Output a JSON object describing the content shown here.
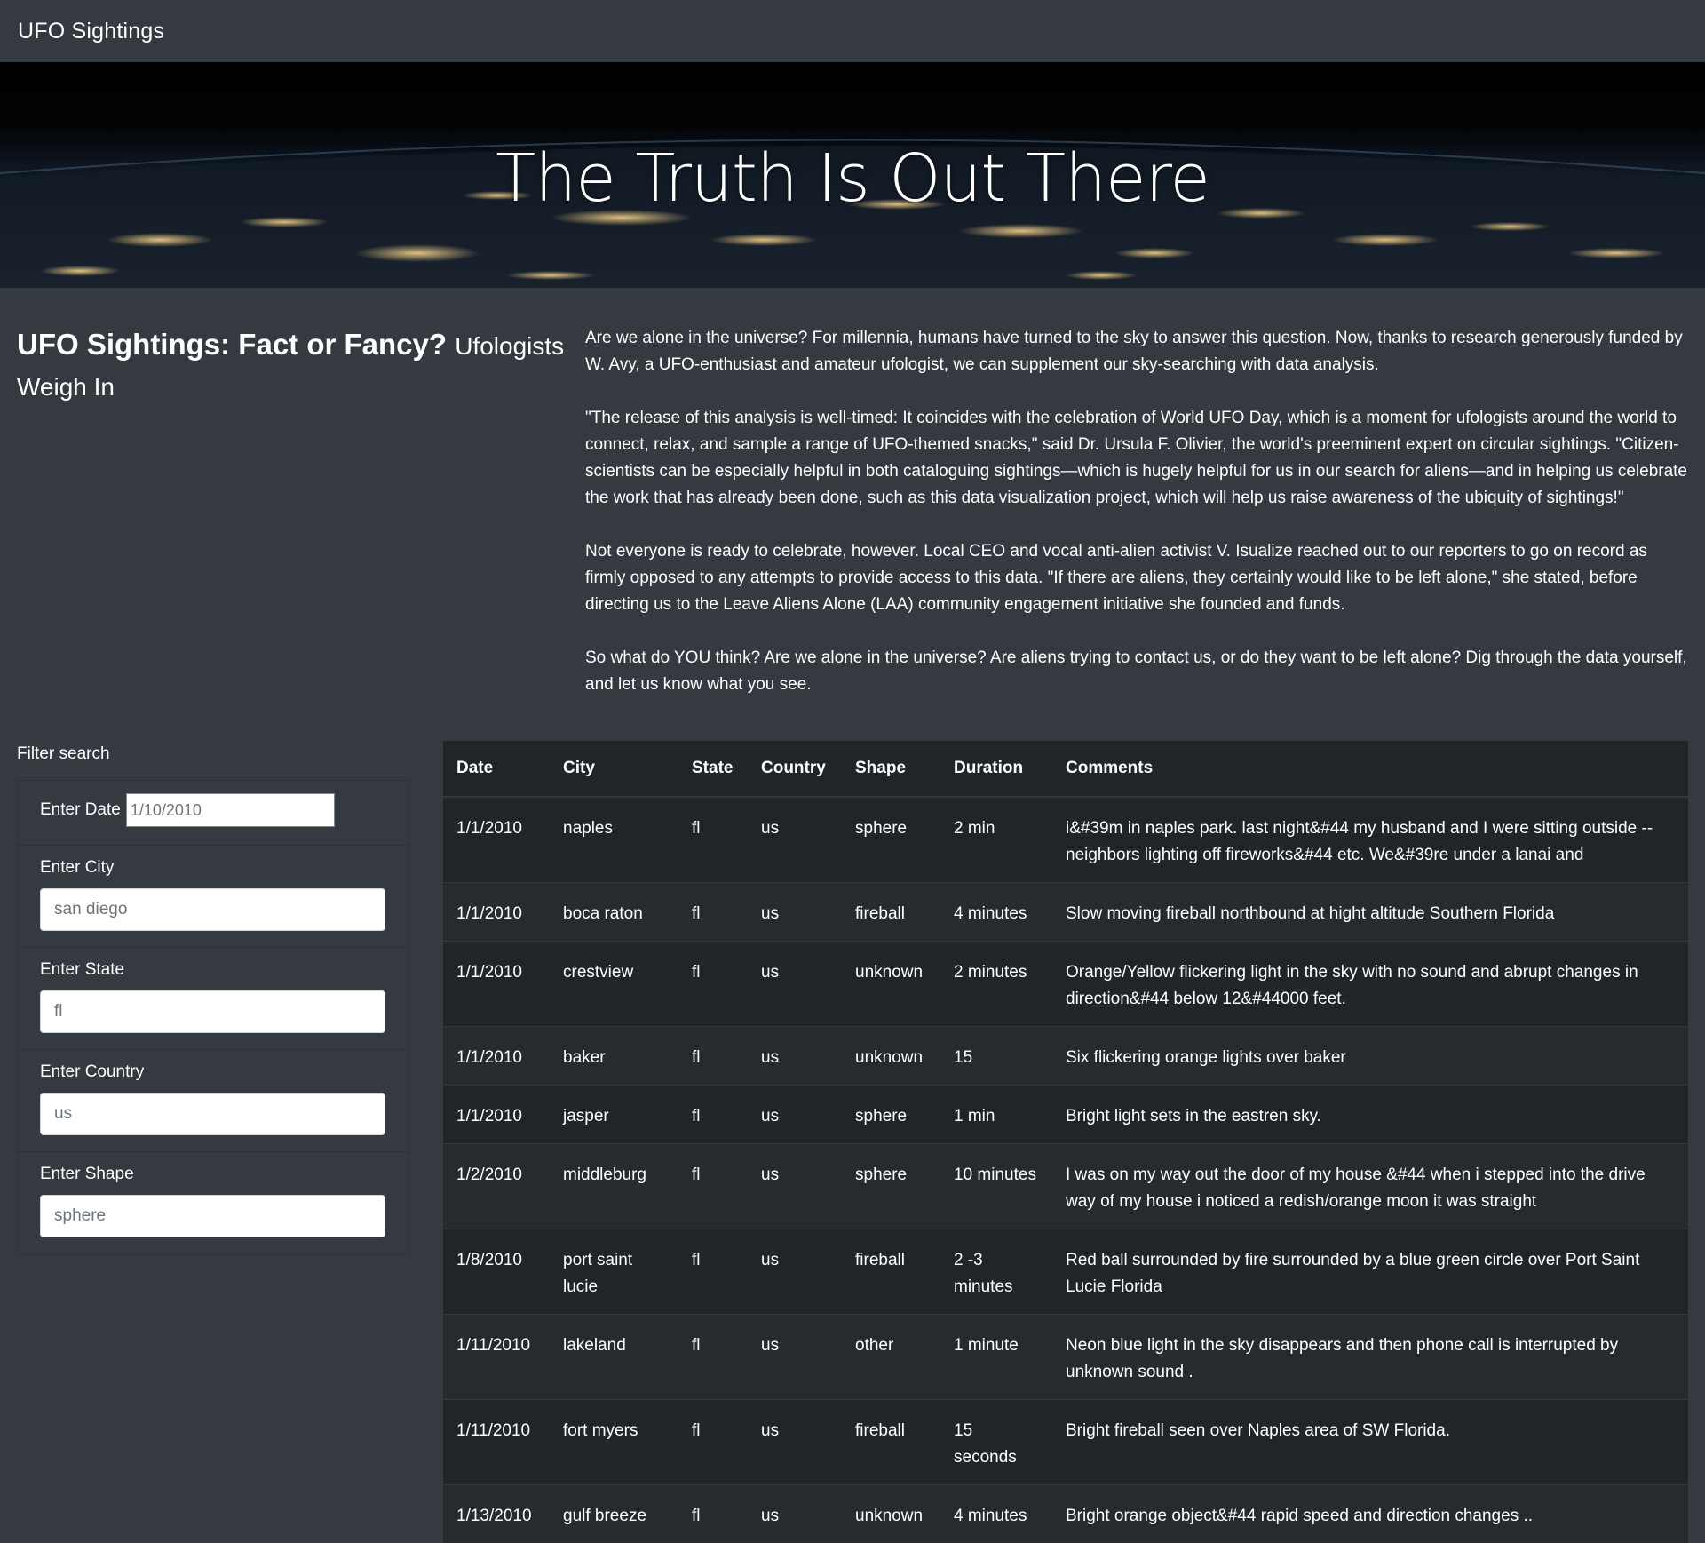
{
  "navbar": {
    "brand": "UFO Sightings"
  },
  "hero": {
    "title": "The Truth Is Out There"
  },
  "intro": {
    "heading": "UFO Sightings: Fact or Fancy?",
    "subheading": "Ufologists Weigh In",
    "paragraphs": [
      "Are we alone in the universe? For millennia, humans have turned to the sky to answer this question. Now, thanks to research generously funded by W. Avy, a UFO-enthusiast and amateur ufologist, we can supplement our sky-searching with data analysis.",
      "\"The release of this analysis is well-timed: It coincides with the celebration of World UFO Day, which is a moment for ufologists around the world to connect, relax, and sample a range of UFO-themed snacks,\" said Dr. Ursula F. Olivier, the world's preeminent expert on circular sightings. \"Citizen-scientists can be especially helpful in both cataloguing sightings—which is hugely helpful for us in our search for aliens—and in helping us celebrate the work that has already been done, such as this data visualization project, which will help us raise awareness of the ubiquity of sightings!\"",
      "Not everyone is ready to celebrate, however. Local CEO and vocal anti-alien activist V. Isualize reached out to our reporters to go on record as firmly opposed to any attempts to provide access to this data. \"If there are aliens, they certainly would like to be left alone,\" she stated, before directing us to the Leave Aliens Alone (LAA) community engagement initiative she founded and funds.",
      "So what do YOU think? Are we alone in the universe? Are aliens trying to contact us, or do they want to be left alone? Dig through the data yourself, and let us know what you see."
    ]
  },
  "filters": {
    "title": "Filter search",
    "date": {
      "label": "Enter Date",
      "placeholder": "1/10/2010"
    },
    "city": {
      "label": "Enter City",
      "placeholder": "san diego"
    },
    "state": {
      "label": "Enter State",
      "placeholder": "fl"
    },
    "country": {
      "label": "Enter Country",
      "placeholder": "us"
    },
    "shape": {
      "label": "Enter Shape",
      "placeholder": "sphere"
    }
  },
  "table": {
    "headers": {
      "date": "Date",
      "city": "City",
      "state": "State",
      "country": "Country",
      "shape": "Shape",
      "duration": "Duration",
      "comments": "Comments"
    },
    "rows": [
      {
        "date": "1/1/2010",
        "city": "naples",
        "state": "fl",
        "country": "us",
        "shape": "sphere",
        "duration": "2 min",
        "comments": "i&#39m in naples park. last night&#44 my husband and I were sitting outside --neighbors lighting off fireworks&#44 etc. We&#39re under a lanai and"
      },
      {
        "date": "1/1/2010",
        "city": "boca raton",
        "state": "fl",
        "country": "us",
        "shape": "fireball",
        "duration": "4 minutes",
        "comments": "Slow moving fireball northbound at hight altitude Southern Florida"
      },
      {
        "date": "1/1/2010",
        "city": "crestview",
        "state": "fl",
        "country": "us",
        "shape": "unknown",
        "duration": "2 minutes",
        "comments": "Orange/Yellow flickering light in the sky with no sound and abrupt changes in direction&#44 below 12&#44000 feet."
      },
      {
        "date": "1/1/2010",
        "city": "baker",
        "state": "fl",
        "country": "us",
        "shape": "unknown",
        "duration": "15",
        "comments": "Six flickering orange lights over baker"
      },
      {
        "date": "1/1/2010",
        "city": "jasper",
        "state": "fl",
        "country": "us",
        "shape": "sphere",
        "duration": "1 min",
        "comments": "Bright light sets in the eastren sky."
      },
      {
        "date": "1/2/2010",
        "city": "middleburg",
        "state": "fl",
        "country": "us",
        "shape": "sphere",
        "duration": "10 minutes",
        "comments": "I was on my way out the door of my house &#44 when i stepped into the drive way of my house i noticed a redish/orange moon it was straight"
      },
      {
        "date": "1/8/2010",
        "city": "port saint lucie",
        "state": "fl",
        "country": "us",
        "shape": "fireball",
        "duration": "2 -3 minutes",
        "comments": "Red ball surrounded by fire surrounded by a blue green circle over Port Saint Lucie Florida"
      },
      {
        "date": "1/11/2010",
        "city": "lakeland",
        "state": "fl",
        "country": "us",
        "shape": "other",
        "duration": "1 minute",
        "comments": "Neon blue light in the sky disappears and then phone call is interrupted by unknown sound ."
      },
      {
        "date": "1/11/2010",
        "city": "fort myers",
        "state": "fl",
        "country": "us",
        "shape": "fireball",
        "duration": "15 seconds",
        "comments": "Bright fireball seen over Naples area of SW Florida."
      },
      {
        "date": "1/13/2010",
        "city": "gulf breeze",
        "state": "fl",
        "country": "us",
        "shape": "unknown",
        "duration": "4 minutes",
        "comments": "Bright orange object&#44 rapid speed and direction changes .."
      }
    ]
  },
  "colors": {
    "page_bg": "#343a40",
    "table_bg": "#212529",
    "text": "#ffffff"
  }
}
